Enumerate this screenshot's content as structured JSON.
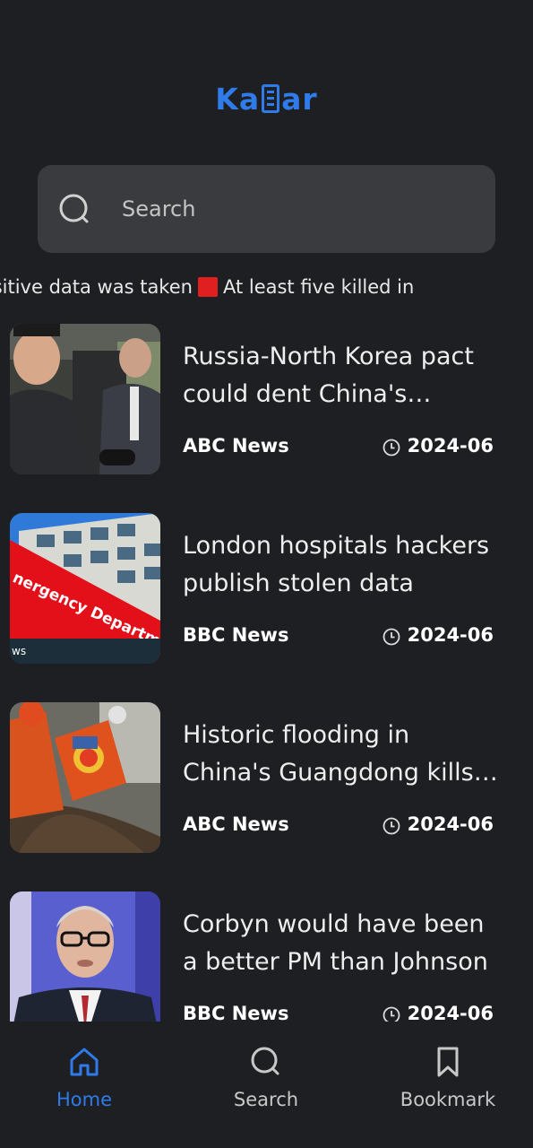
{
  "app": {
    "logo_text_left": "Ka",
    "logo_text_right": "ar"
  },
  "search": {
    "placeholder": "Search"
  },
  "ticker": {
    "items": [
      "Hackers say no sensitive data was taken",
      "At least five killed in"
    ]
  },
  "articles": [
    {
      "headline": "Russia-North Korea pact could dent China's influence",
      "source": "ABC News",
      "date": "2024-06"
    },
    {
      "headline": "London hospitals hackers publish stolen data",
      "source": "BBC News",
      "date": "2024-06"
    },
    {
      "headline": "Historic flooding in China's Guangdong kills dozens",
      "source": "ABC News",
      "date": "2024-06"
    },
    {
      "headline": "Corbyn would have been a better PM than Johnson",
      "source": "BBC News",
      "date": "2024-06"
    }
  ],
  "thumb_text": {
    "sign_main": "nergency Department (A&E)",
    "sign_small": "ws"
  },
  "nav": {
    "home": "Home",
    "search": "Search",
    "bookmark": "Bookmark"
  },
  "colors": {
    "accent": "#2f7be9",
    "background": "#1e1f23",
    "search_bg": "#3a3b3e",
    "ticker_separator": "#e02020"
  }
}
